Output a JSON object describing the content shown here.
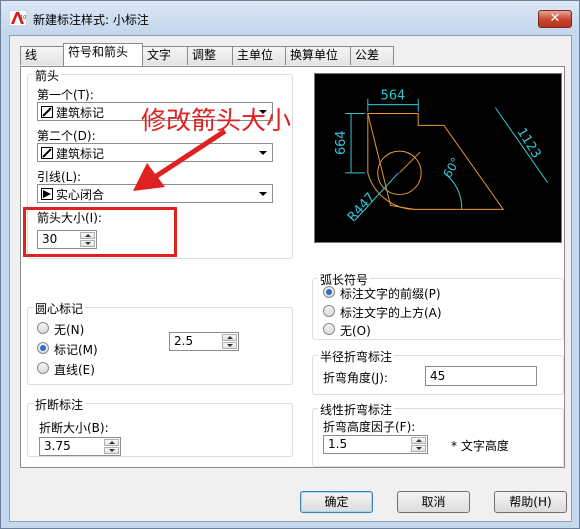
{
  "window": {
    "title": "新建标注样式: 小标注",
    "app_icon": "autocad-icon",
    "close_icon": "close-icon",
    "close_glyph": "✕"
  },
  "tabs": [
    {
      "label": "线"
    },
    {
      "label": "符号和箭头",
      "active": true
    },
    {
      "label": "文字"
    },
    {
      "label": "调整"
    },
    {
      "label": "主单位"
    },
    {
      "label": "换算单位"
    },
    {
      "label": "公差"
    }
  ],
  "arrowheads": {
    "group_label": "箭头",
    "first_label": "第一个(T):",
    "first_value": "建筑标记",
    "second_label": "第二个(D):",
    "second_value": "建筑标记",
    "leader_label": "引线(L):",
    "leader_value": "实心闭合",
    "size_label": "箭头大小(I):",
    "size_value": "30"
  },
  "center_marks": {
    "group_label": "圆心标记",
    "options": [
      "无(N)",
      "标记(M)",
      "直线(E)"
    ],
    "selected": "标记(M)",
    "size_value": "2.5"
  },
  "dim_break": {
    "group_label": "折断标注",
    "size_label": "折断大小(B):",
    "size_value": "3.75"
  },
  "arc_length": {
    "group_label": "弧长符号",
    "options": [
      "标注文字的前缀(P)",
      "标注文字的上方(A)",
      "无(O)"
    ],
    "selected": "标注文字的前缀(P)"
  },
  "radius_jog": {
    "group_label": "半径折弯标注",
    "angle_label": "折弯角度(J):",
    "angle_value": "45"
  },
  "linear_jog": {
    "group_label": "线性折弯标注",
    "factor_label": "折弯高度因子(F):",
    "factor_value": "1.5",
    "suffix": "* 文字高度"
  },
  "preview": {
    "dim_top": "564",
    "dim_left": "664",
    "dim_right": "1123",
    "dim_angle": "60°",
    "dim_radius": "R447",
    "line_color": "#e69a2e",
    "dim_color": "#35c7d6"
  },
  "buttons": {
    "ok": "确定",
    "cancel": "取消",
    "help": "帮助(H)"
  },
  "annotation": {
    "text": "修改箭头大小",
    "color": "#e02121"
  }
}
